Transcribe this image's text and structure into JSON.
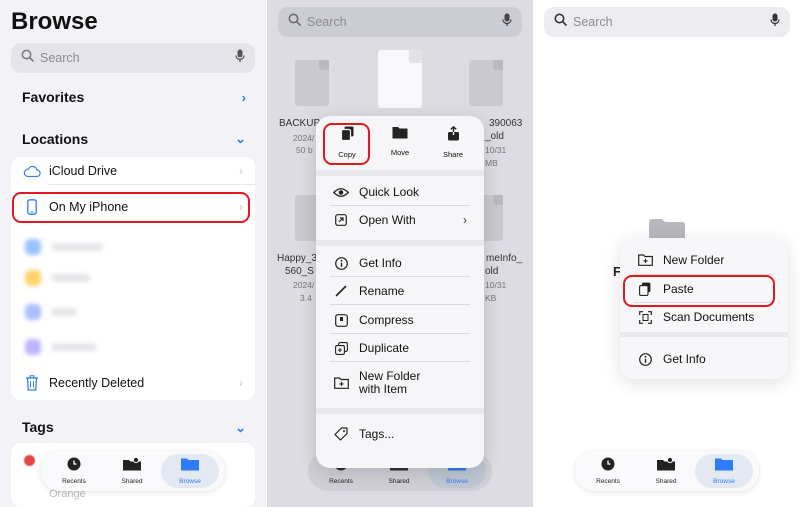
{
  "browse": {
    "title": "Browse",
    "search_placeholder": "Search",
    "favorites_label": "Favorites",
    "locations_label": "Locations",
    "locations": [
      {
        "label": "iCloud Drive",
        "icon": "cloud-icon"
      },
      {
        "label": "On My iPhone",
        "icon": "phone-icon"
      },
      {
        "label": "Recently Deleted",
        "icon": "trash-icon"
      }
    ],
    "tags_label": "Tags",
    "tag_partial": "Orange"
  },
  "tabbar": {
    "recents": "Recents",
    "shared": "Shared",
    "browse": "Browse"
  },
  "files": {
    "search_placeholder": "Search",
    "items": [
      {
        "name": "BACKUP_",
        "meta1": "2024/",
        "meta2": "50 b"
      },
      {
        "name": "390063",
        "name2": "_old",
        "meta1": "10/31",
        "meta2": "MB"
      },
      {
        "name": "Happy_3",
        "name2": "560_S",
        "meta1": "2024/",
        "meta2": "3.4"
      },
      {
        "name": "meInfo_",
        "name2": "old",
        "meta1": "10/31",
        "meta2": "KB"
      }
    ]
  },
  "context_menu": {
    "quick_actions": [
      {
        "label": "Copy",
        "icon": "copy-icon"
      },
      {
        "label": "Move",
        "icon": "folder-icon"
      },
      {
        "label": "Share",
        "icon": "share-icon"
      }
    ],
    "items": [
      {
        "label": "Quick Look",
        "icon": "eye-icon"
      },
      {
        "label": "Open With",
        "icon": "open-with-icon"
      },
      {
        "label": "Get Info",
        "icon": "info-icon"
      },
      {
        "label": "Rename",
        "icon": "pencil-icon"
      },
      {
        "label": "Compress",
        "icon": "archive-icon"
      },
      {
        "label": "Duplicate",
        "icon": "duplicate-icon"
      },
      {
        "label": "New Folder\nwith Item",
        "label1": "New Folder",
        "label2": "with Item",
        "icon": "new-folder-icon"
      },
      {
        "label": "Tags...",
        "icon": "tag-icon"
      }
    ]
  },
  "paste_popup": {
    "search_placeholder": "Search",
    "items": [
      {
        "label": "New Folder",
        "icon": "new-folder-icon"
      },
      {
        "label": "Paste",
        "icon": "paste-icon"
      },
      {
        "label": "Scan Documents",
        "icon": "scan-icon"
      },
      {
        "label": "Get Info",
        "icon": "info-icon"
      }
    ]
  },
  "colors": {
    "accent": "#2f7cf6",
    "highlight": "#e0191f",
    "tag_red": "#e04848"
  }
}
